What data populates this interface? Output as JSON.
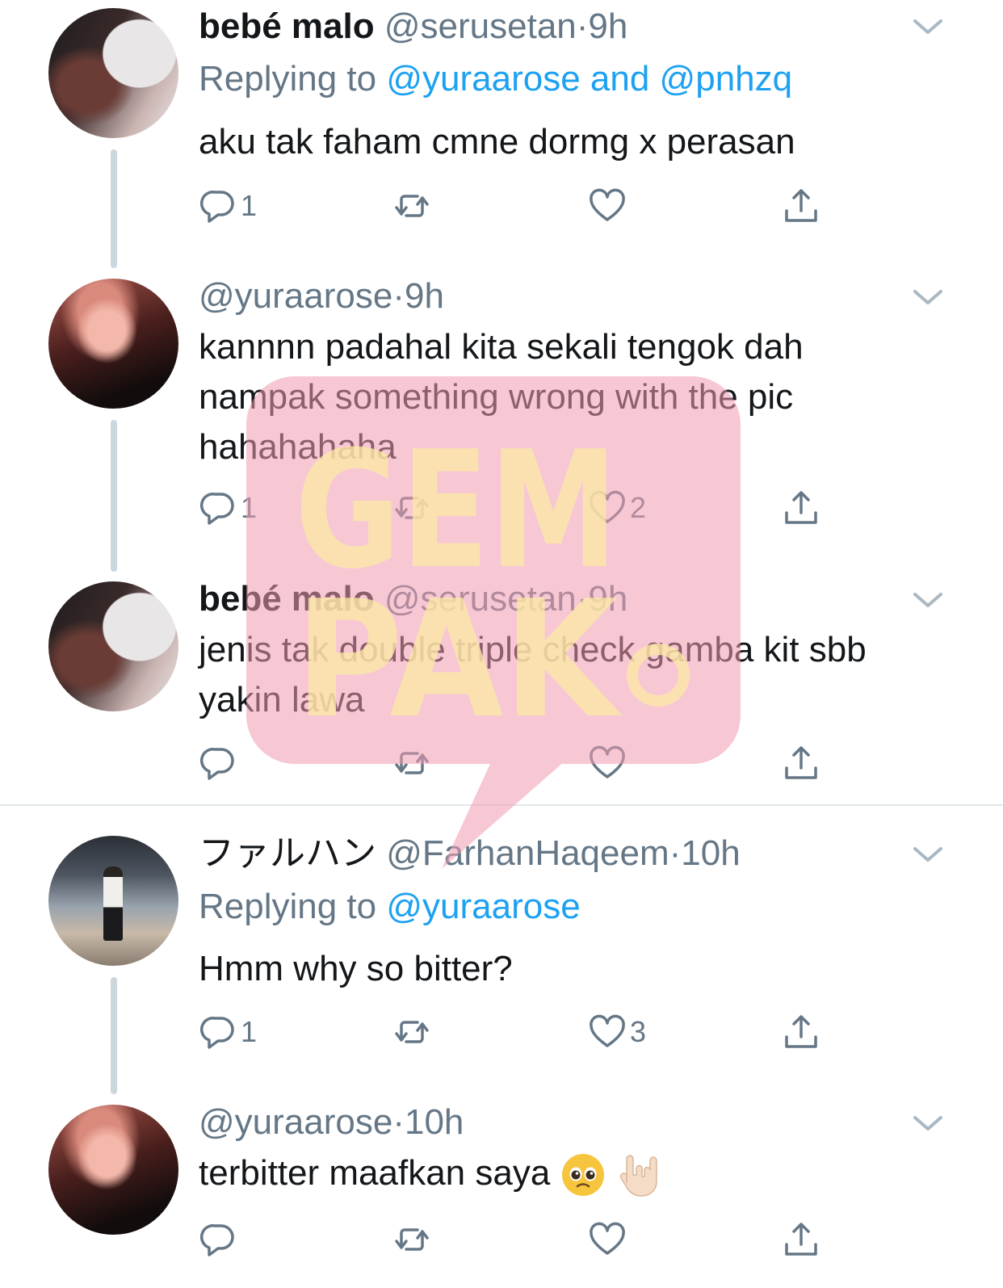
{
  "tweets": [
    {
      "name": "bebé malo",
      "handle": "@serusetan",
      "dot": "·",
      "time": "9h",
      "replying_prefix": "Replying to",
      "replying_mentions": "@yuraarose and @pnhzq",
      "text": "aku tak faham cmne dormg x perasan",
      "reply_count": "1",
      "retweet_count": "",
      "like_count": ""
    },
    {
      "name": "",
      "handle": "@yuraarose",
      "dot": "·",
      "time": "9h",
      "text_lines": [
        "kannnn padahal kita sekali tengok dah",
        "nampak something wrong with the pic",
        "hahahahaha"
      ],
      "reply_count": "1",
      "retweet_count": "",
      "like_count": "2"
    },
    {
      "name": "bebé malo",
      "handle": "@serusetan",
      "dot": "·",
      "time": "9h",
      "text_lines": [
        "jenis tak double triple check gamba kit sbb",
        "yakin lawa"
      ],
      "reply_count": "",
      "retweet_count": "",
      "like_count": ""
    },
    {
      "name": "ファルハン",
      "handle": "@FarhanHaqeem",
      "dot": "·",
      "time": "10h",
      "replying_prefix": "Replying to",
      "replying_mentions": "@yuraarose",
      "text": "Hmm why so bitter?",
      "reply_count": "1",
      "retweet_count": "",
      "like_count": "3"
    },
    {
      "name": "",
      "handle": "@yuraarose",
      "dot": "·",
      "time": "10h",
      "text": "terbitter maafkan saya",
      "reply_count": "",
      "retweet_count": "",
      "like_count": ""
    }
  ],
  "icons": {
    "reply": "reply-icon",
    "retweet": "retweet-icon",
    "like": "heart-icon",
    "share": "share-icon",
    "more": "chevron-down-icon"
  },
  "colors": {
    "text": "#14171a",
    "secondary": "#657786",
    "link": "#1da1f2",
    "thread_line": "#ccd6dd",
    "watermark_pink": "#f7a8b8",
    "watermark_yellow": "#fbe7a6"
  },
  "watermark": {
    "line1": "GEM",
    "line2": "PAK"
  }
}
